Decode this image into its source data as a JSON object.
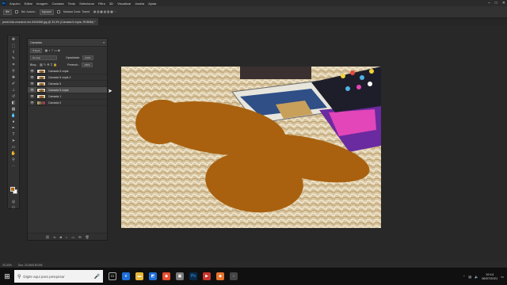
{
  "menubar": {
    "app_logo": "Ps",
    "items": [
      "Arquivo",
      "Editar",
      "Imagem",
      "Camada",
      "Texto",
      "Selecionar",
      "Filtro",
      "3D",
      "Visualizar",
      "Janela",
      "Ajuda"
    ]
  },
  "window_controls": {
    "minimize": "–",
    "maximize": "□",
    "close": "✕"
  },
  "options_bar": {
    "tool_icon": "vector-selection-icon",
    "auto_select_label": "Sel. Autom.:",
    "auto_select_value": "Agrupar",
    "transform_label": "Mostrar Contr. Transf."
  },
  "document": {
    "tab_title": "pexel-foto-monarch-em-5434368.jpg @ 33,3% (Camada 5 cópia, RGB/8#) *"
  },
  "toolbar": {
    "tools": [
      "move-icon",
      "marquee-icon",
      "lasso-icon",
      "quick-select-icon",
      "crop-icon",
      "eyedropper-icon",
      "healing-icon",
      "brush-icon",
      "stamp-icon",
      "history-brush-icon",
      "eraser-icon",
      "gradient-icon",
      "blur-icon",
      "dodge-icon",
      "pen-icon",
      "type-icon",
      "path-select-icon",
      "shape-icon",
      "hand-icon",
      "zoom-icon",
      "edit-toolbar-icon"
    ],
    "foreground_color": "#b3670d",
    "background_color": "#ffffff"
  },
  "layers_panel": {
    "title": "Camadas",
    "filter_kind": "Tipo",
    "blend_mode": "Normal",
    "opacity_label": "Opacidade:",
    "opacity_value": "100%",
    "lock_label": "Bloq.:",
    "fill_label": "Preench.:",
    "fill_value": "100%",
    "layers": [
      {
        "name": "Camada 5 cópia",
        "selected": false,
        "thumb": "shape"
      },
      {
        "name": "Camada 5 cópia 2",
        "selected": false,
        "thumb": "shape"
      },
      {
        "name": "Camada 5",
        "selected": false,
        "thumb": "shape"
      },
      {
        "name": "Camada 5 cópia",
        "selected": true,
        "thumb": "shape"
      },
      {
        "name": "Camada 1",
        "selected": false,
        "thumb": "shape"
      },
      {
        "name": "Camada 0",
        "selected": false,
        "thumb": "photo"
      }
    ]
  },
  "canvas": {
    "shape_color": "#a9610f",
    "rug_color": "#d9c7a2"
  },
  "status_bar": {
    "zoom": "33,33%",
    "doc_info": "Doc: 23,0M/150,9M"
  },
  "taskbar": {
    "search_placeholder": "Digite aqui para pesquisar",
    "time": "19:14",
    "date": "06/07/2021"
  }
}
